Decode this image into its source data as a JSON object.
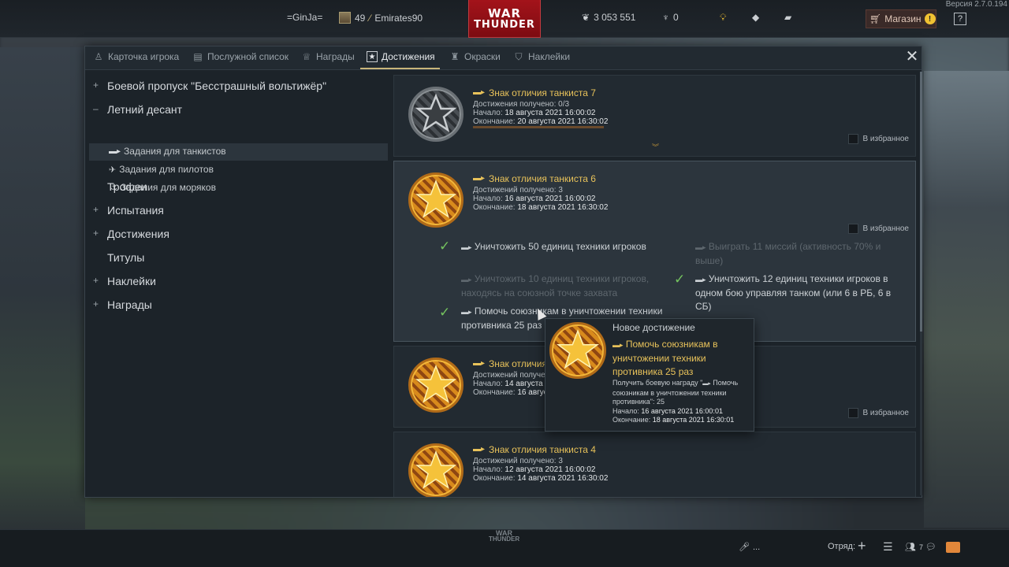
{
  "topbar": {
    "version": "Версия 2.7.0.194",
    "player_name": "=GinJa=",
    "level": "49",
    "squadron_name": "Emirates90",
    "logo_line1": "WAR",
    "logo_line2": "THUNDER",
    "silver_lions": "3 053 551",
    "golden_eagles": "0",
    "shop_label": "Магазин",
    "shop_badge": "!",
    "help_label": "?"
  },
  "tabs": [
    {
      "label": "Карточка игрока",
      "icon": "soldier-icon"
    },
    {
      "label": "Послужной список",
      "icon": "scroll-icon"
    },
    {
      "label": "Награды",
      "icon": "medal-icon"
    },
    {
      "label": "Достижения",
      "icon": "star-icon",
      "active": true
    },
    {
      "label": "Окраски",
      "icon": "brush-icon"
    },
    {
      "label": "Наклейки",
      "icon": "shield-icon"
    }
  ],
  "tree": {
    "items": [
      {
        "pm": "+",
        "label": "Боевой пропуск \"Бесстрашный вольтижёр\""
      },
      {
        "pm": "–",
        "label": "Летний десант"
      },
      {
        "pm": "",
        "label": "Трофеи"
      },
      {
        "pm": "+",
        "label": "Испытания"
      },
      {
        "pm": "+",
        "label": "Достижения"
      },
      {
        "pm": "",
        "label": "Титулы"
      },
      {
        "pm": "+",
        "label": "Наклейки"
      },
      {
        "pm": "+",
        "label": "Награды"
      }
    ],
    "subitems": [
      {
        "label": "Задания для танкистов",
        "icon": "tank-icon"
      },
      {
        "label": "Задания для пилотов",
        "icon": "plane-icon"
      },
      {
        "label": "Задания для моряков",
        "icon": "ship-icon"
      }
    ]
  },
  "cards": [
    {
      "title": "Знак отличия танкиста 7",
      "progress": "Достижения получено: 0/3",
      "start_label": "Начало:",
      "start": "18 августа 2021 16:00:02",
      "end_label": "Окончание:",
      "end": "20 августа 2021 16:30:02",
      "fav": "В избранное",
      "medal": "grey"
    },
    {
      "title": "Знак отличия танкиста 6",
      "progress": "Достижений получено: 3",
      "start_label": "Начало:",
      "start": "16 августа 2021 16:00:02",
      "end_label": "Окончание:",
      "end": "18 августа 2021 16:30:02",
      "fav": "В избранное",
      "medal": "gold"
    },
    {
      "title": "Знак отличия танкиста 5",
      "progress": "Достижений получено: 3",
      "start_label": "Начало:",
      "start": "14 августа 2021 16:00:02",
      "end_label": "Окончание:",
      "end": "16 августа 2021 16:30:02",
      "fav": "В избранное",
      "medal": "gold"
    },
    {
      "title": "Знак отличия танкиста 4",
      "progress": "Достижений получено: 3",
      "start_label": "Начало:",
      "start": "12 августа 2021 16:00:02",
      "end_label": "Окончание:",
      "end": "14 августа 2021 16:30:02",
      "fav": "В избранное",
      "medal": "gold"
    }
  ],
  "tasks": [
    {
      "text": "Уничтожить 50 единиц техники игроков",
      "done": true
    },
    {
      "text": "Выиграть 11 миссий (активность 70% и выше)",
      "done": false
    },
    {
      "text": "Уничтожить 10 единиц техники игроков, находясь на союзной точке захвата",
      "done": false
    },
    {
      "text": "Уничтожить 12 единиц техники игроков в одном бою управляя танком (или 6 в РБ, 6 в СБ)",
      "done": true
    },
    {
      "text": "Помочь союзникам в уничтожении техники противника 25 раз",
      "done": true
    }
  ],
  "tooltip": {
    "header": "Новое достижение",
    "title": "Помочь союзникам в уничтожении техники противника 25 раз",
    "reward_text": "Получить боевую награду \"",
    "reward_name": " Помочь союзникам в уничтожении техники противника\": 25",
    "start_label": "Начало:",
    "start": "16 августа 2021 16:00:01",
    "end_label": "Окончание:",
    "end": "18 августа 2021 16:30:01"
  },
  "bottombar": {
    "logo_line1": "WAR",
    "logo_line2": "THUNDER",
    "voice_label": "...",
    "squad_label": "Отряд:",
    "friends_count": "7"
  },
  "colors": {
    "accent_gold": "#e8c25a",
    "logo_red": "#a3131a",
    "check_green": "#74c35f"
  }
}
